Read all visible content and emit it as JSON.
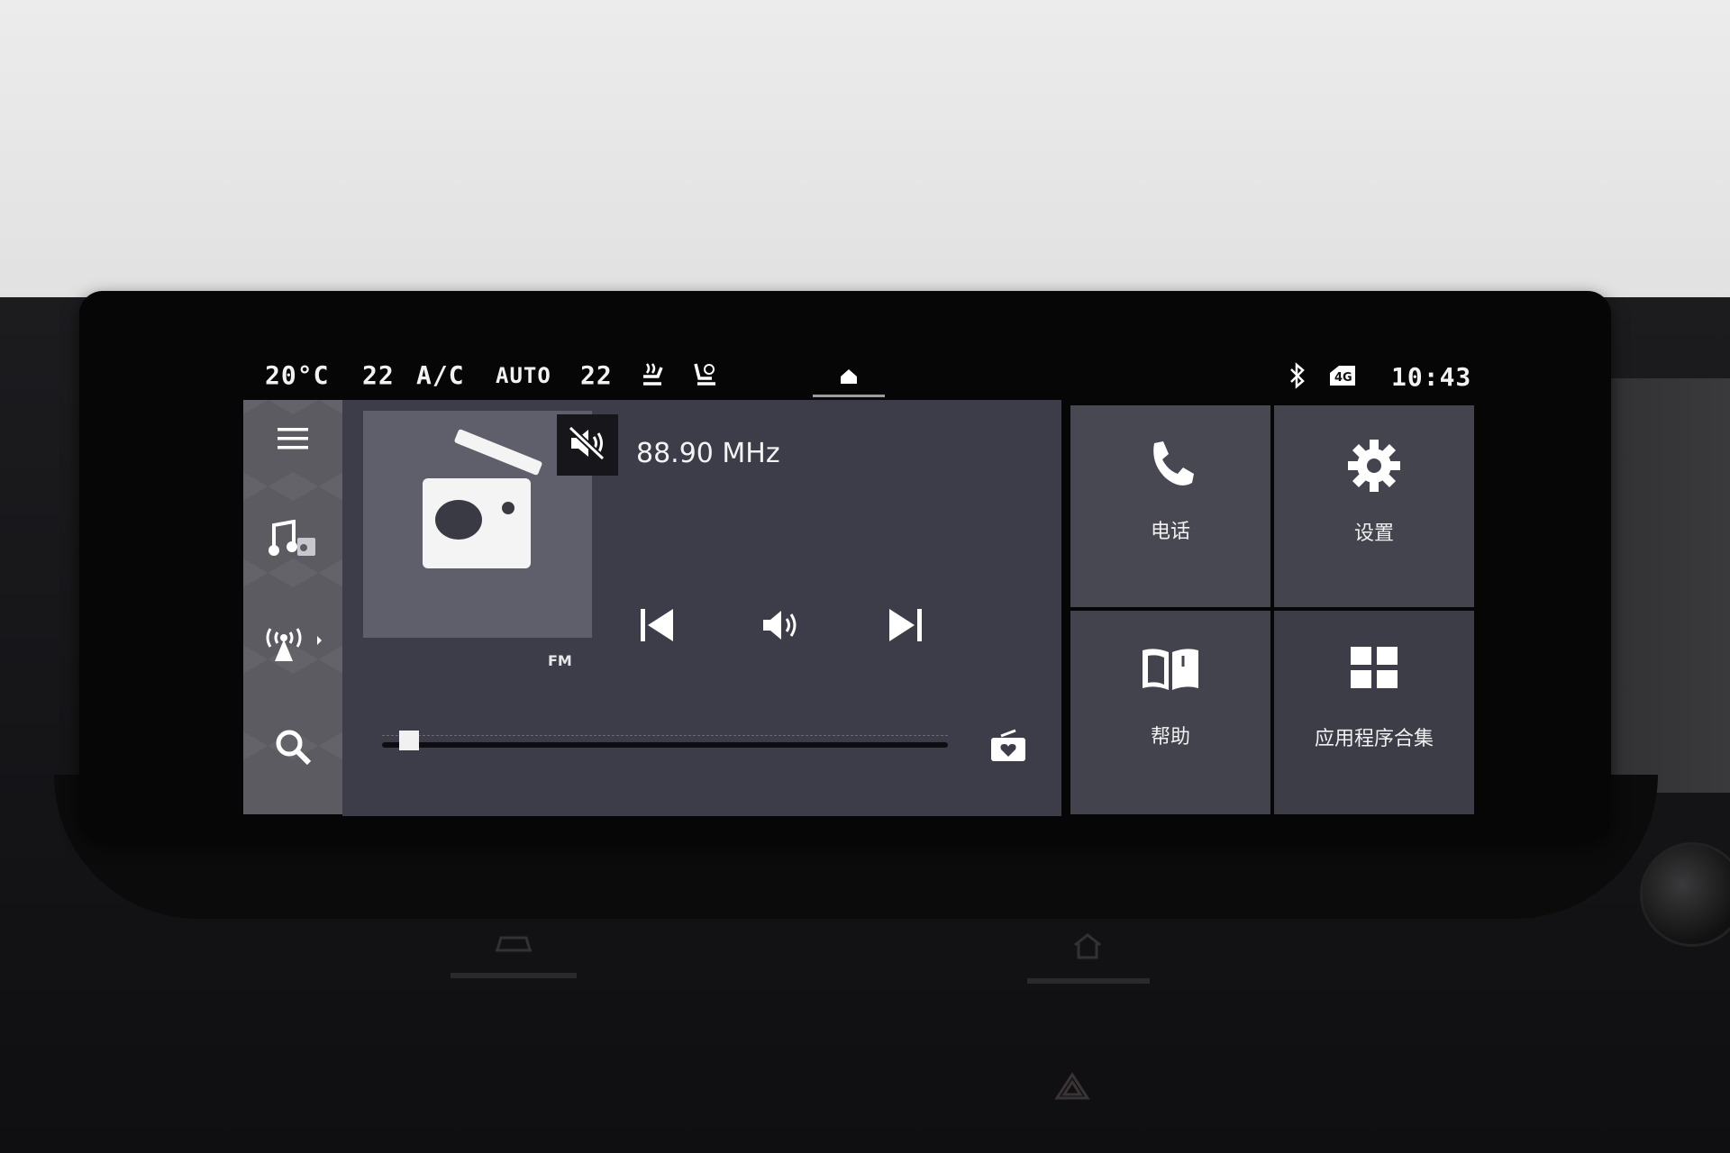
{
  "status_bar": {
    "outside_temp": "20°C",
    "left_temp": "22",
    "ac_label": "A/C",
    "auto_label": "AUTO",
    "right_temp": "22",
    "time": "10:43",
    "network_badge": "4G",
    "icons": [
      "seat-heat-icon",
      "seat-vent-icon",
      "home-icon",
      "bluetooth-icon",
      "network-4g-icon"
    ]
  },
  "sidebar": {
    "items": [
      {
        "name": "menu",
        "icon": "menu-icon"
      },
      {
        "name": "music",
        "icon": "music-note-icon"
      },
      {
        "name": "radio",
        "icon": "radio-antenna-icon"
      },
      {
        "name": "search",
        "icon": "search-icon"
      }
    ]
  },
  "media": {
    "frequency": "88.90 MHz",
    "band": "FM",
    "muted": true,
    "tuner_position": 0.04,
    "controls": [
      "previous-track-icon",
      "volume-icon",
      "next-track-icon",
      "favorite-radio-icon"
    ]
  },
  "tiles": [
    {
      "label": "电话",
      "icon": "phone-icon"
    },
    {
      "label": "设置",
      "icon": "gear-icon"
    },
    {
      "label": "帮助",
      "icon": "book-icon"
    },
    {
      "label": "应用程序合集",
      "icon": "app-grid-icon"
    }
  ],
  "colors": {
    "media_bg": "#3c3d49",
    "tile_bg": "#44454f",
    "sidebar_bg": "#5b5b61",
    "album_bg": "#5f5f6b"
  }
}
